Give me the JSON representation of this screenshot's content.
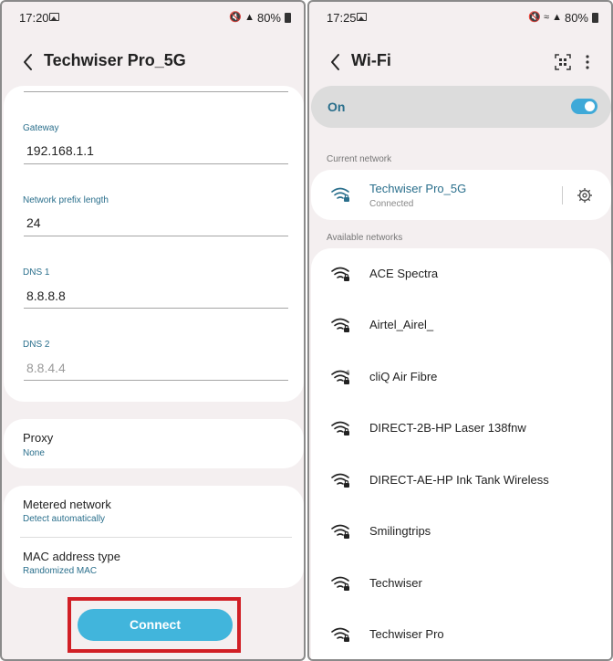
{
  "left": {
    "status": {
      "time": "17:20",
      "battery": "80%"
    },
    "title": "Techwiser Pro_5G",
    "fields": [
      {
        "label": "Gateway",
        "value": "192.168.1.1"
      },
      {
        "label": "Network prefix length",
        "value": "24"
      },
      {
        "label": "DNS 1",
        "value": "8.8.8.8"
      },
      {
        "label": "DNS 2",
        "placeholder": "8.8.4.4"
      }
    ],
    "proxy": {
      "title": "Proxy",
      "value": "None"
    },
    "metered": {
      "title": "Metered network",
      "value": "Detect automatically"
    },
    "mac": {
      "title": "MAC address type",
      "value": "Randomized MAC"
    },
    "connect_label": "Connect",
    "highlight_color": "#d11f26"
  },
  "right": {
    "status": {
      "time": "17:25",
      "battery": "80%"
    },
    "title": "Wi-Fi",
    "toggle_label": "On",
    "toggle_on": true,
    "current_section": "Current network",
    "current_network": {
      "name": "Techwiser Pro_5G",
      "status": "Connected"
    },
    "available_section": "Available networks",
    "networks": [
      {
        "name": "ACE Spectra",
        "icon": "wifi-locked-icon"
      },
      {
        "name": "Airtel_Airel_",
        "icon": "wifi-locked-icon"
      },
      {
        "name": "cliQ Air Fibre",
        "icon": "wifi-6-locked-icon"
      },
      {
        "name": "DIRECT-2B-HP Laser 138fnw",
        "icon": "wifi-locked-icon"
      },
      {
        "name": "DIRECT-AE-HP Ink Tank Wireless",
        "icon": "wifi-locked-icon"
      },
      {
        "name": "Smilingtrips",
        "icon": "wifi-locked-icon"
      },
      {
        "name": "Techwiser",
        "icon": "wifi-locked-icon"
      },
      {
        "name": "Techwiser Pro",
        "icon": "wifi-locked-icon"
      }
    ]
  },
  "colors": {
    "accent": "#2a6f8c",
    "button": "#41b5dc",
    "toggle": "#3fa9d8"
  }
}
